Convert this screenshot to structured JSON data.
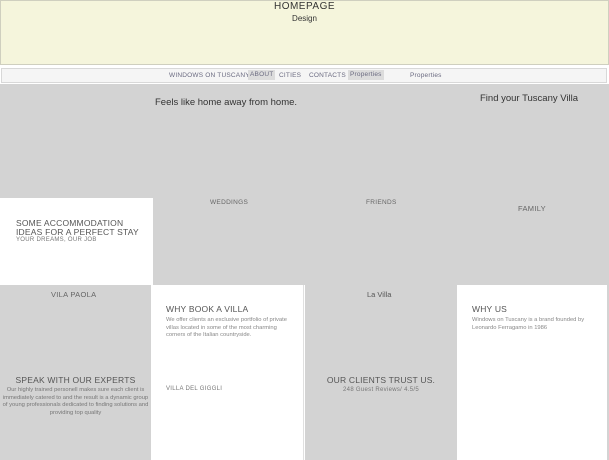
{
  "header": {
    "title": "HOMEPAGE",
    "subtitle": "Design"
  },
  "nav": {
    "items": [
      {
        "label": "WINDOWS ON TUSCANY"
      },
      {
        "label": "ABOUT"
      },
      {
        "label": "CITIES"
      },
      {
        "label": "CONTACTS"
      },
      {
        "label": "Properties"
      },
      {
        "label": "Properties"
      }
    ]
  },
  "hero": {
    "tagline": "Feels like home away from home.",
    "find_villa": "Find your Tuscany Villa"
  },
  "tiles": {
    "weddings": "WEDDINGS",
    "friends": "FRIENDS",
    "family": "FAMILY",
    "vila_paola": "VILA PAOLA",
    "la_villa": "La Villa",
    "villa_del_gigli": "VILLA DEL GIGGLI"
  },
  "accommodation": {
    "title": "SOME ACCOMMODATION IDEAS FOR A PERFECT STAY",
    "subtitle": "YOUR DREAMS, OUR JOB"
  },
  "why_book": {
    "title": "WHY BOOK A VILLA",
    "body": "We offer clients an exclusive portfolio of private villas located in some of the most charming corners of the Italian countryside."
  },
  "why_us": {
    "title": "WHY US",
    "body": "Windows on Tuscany is a brand founded by Leonardo Ferragamo in 1986"
  },
  "experts": {
    "title": "SPEAK WITH OUR EXPERTS",
    "body": "Our highly trained personell makes sure each client is immediately catered to and the result is a dynamic group of young professionals dedicated to finding solutions and providing top quality"
  },
  "trust": {
    "title": "OUR CLIENTS TRUST US.",
    "reviews": "248 Guest Reviews/ 4.5/5"
  }
}
